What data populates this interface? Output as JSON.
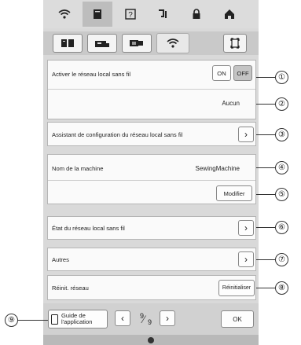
{
  "top_tabs": [
    {
      "icon": "wifi-icon",
      "glyph": "ᯤ"
    },
    {
      "icon": "page-icon",
      "glyph": "▤"
    },
    {
      "icon": "help-icon",
      "glyph": "?"
    },
    {
      "icon": "sewing-icon",
      "glyph": "⌁"
    },
    {
      "icon": "lock-icon",
      "glyph": "🔒︎"
    },
    {
      "icon": "home-icon",
      "glyph": "⌂"
    }
  ],
  "sub_tabs": [
    {
      "icon": "settings-book-icon",
      "glyph": "▥"
    },
    {
      "icon": "machine-icon",
      "glyph": "▬"
    },
    {
      "icon": "embroidery-icon",
      "glyph": "▣"
    },
    {
      "icon": "wifi-icon",
      "glyph": "ᯤ"
    }
  ],
  "wlan": {
    "enable_label": "Activer le réseau local sans fil",
    "on_label": "ON",
    "off_label": "OFF",
    "network_value": "Aucun",
    "assistant_label": "Assistant de configuration du réseau local sans fil",
    "machine_name_label": "Nom de la machine",
    "machine_name_value": "SewingMachine",
    "modify_label": "Modifier",
    "status_label": "État du réseau local sans fil",
    "others_label": "Autres",
    "reset_label": "Réinit. réseau",
    "reset_button": "Réinitialiser"
  },
  "bottom": {
    "guide_line1": "Guide de",
    "guide_line2": "l'application",
    "page_current": "9",
    "page_total": "9",
    "ok_label": "OK"
  },
  "callouts": [
    "①",
    "②",
    "③",
    "④",
    "⑤",
    "⑥",
    "⑦",
    "⑧",
    "⑨"
  ]
}
